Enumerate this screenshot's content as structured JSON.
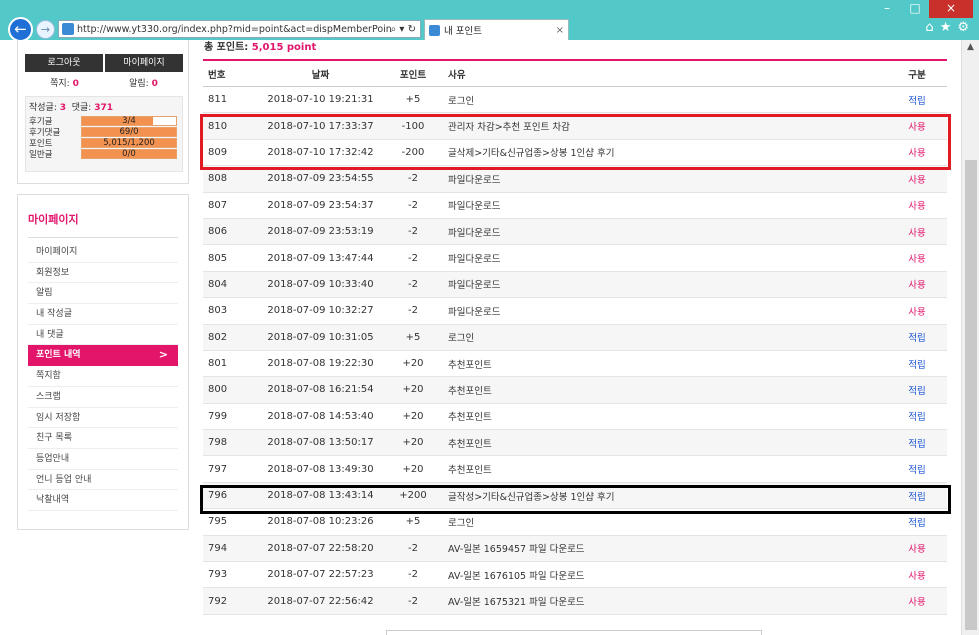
{
  "browser": {
    "url": "http://www.yt330.org/index.php?mid=point&act=dispMemberPointHistory",
    "address_icons": "⌕ ▾ ↻",
    "tab_label": "내 포인트",
    "tab_close": "×",
    "win_minimize": "–",
    "win_maximize": "□",
    "win_close": "×",
    "back": "←",
    "forward": "→",
    "home_icon": "⌂",
    "star_icon": "★",
    "gear_icon": "⚙"
  },
  "sidebar": {
    "logout": "로그아웃",
    "mypage": "마이페이지",
    "note_label": "쪽지: ",
    "note_count": "0",
    "alert_label": "알림: ",
    "alert_count": "0",
    "posts_label": "작성글: ",
    "posts_count": "3",
    "comments_label": "댓글: ",
    "comments_count": "371",
    "stats": [
      {
        "label": "후기글",
        "value": "3/4",
        "fill": 0.75
      },
      {
        "label": "후기댓글",
        "value": "69/0",
        "fill": 1.0
      },
      {
        "label": "포인트",
        "value": "5,015/1,200",
        "fill": 1.0
      },
      {
        "label": "일반글",
        "value": "0/0",
        "fill": 1.0
      }
    ],
    "menu_title": "마이페이지",
    "menu": [
      "마이페이지",
      "회원정보",
      "알림",
      "내 작성글",
      "내 댓글",
      "포인트 내역",
      "쪽지함",
      "스크랩",
      "임시 저장함",
      "친구 목록",
      "등업안내",
      "언니 등업 안내",
      "낙찰내역"
    ],
    "active_index": 5,
    "chevron": ">"
  },
  "points": {
    "total_label": "총 포인트: ",
    "total_value": "5,015 point",
    "headers": {
      "no": "번호",
      "date": "날짜",
      "point": "포인트",
      "reason": "사유",
      "type": "구분"
    },
    "rows": [
      {
        "no": "811",
        "date": "2018-07-10 19:21:31",
        "point": "+5",
        "reason": "로그인",
        "type": "적립"
      },
      {
        "no": "810",
        "date": "2018-07-10 17:33:37",
        "point": "-100",
        "reason": "관리자 차감>추천 포인트 차감",
        "type": "사용"
      },
      {
        "no": "809",
        "date": "2018-07-10 17:32:42",
        "point": "-200",
        "reason": "글삭제>기타&신규업종>상봉 1인샵 후기",
        "type": "사용"
      },
      {
        "no": "808",
        "date": "2018-07-09 23:54:55",
        "point": "-2",
        "reason": "파일다운로드",
        "type": "사용"
      },
      {
        "no": "807",
        "date": "2018-07-09 23:54:37",
        "point": "-2",
        "reason": "파일다운로드",
        "type": "사용"
      },
      {
        "no": "806",
        "date": "2018-07-09 23:53:19",
        "point": "-2",
        "reason": "파일다운로드",
        "type": "사용"
      },
      {
        "no": "805",
        "date": "2018-07-09 13:47:44",
        "point": "-2",
        "reason": "파일다운로드",
        "type": "사용"
      },
      {
        "no": "804",
        "date": "2018-07-09 10:33:40",
        "point": "-2",
        "reason": "파일다운로드",
        "type": "사용"
      },
      {
        "no": "803",
        "date": "2018-07-09 10:32:27",
        "point": "-2",
        "reason": "파일다운로드",
        "type": "사용"
      },
      {
        "no": "802",
        "date": "2018-07-09 10:31:05",
        "point": "+5",
        "reason": "로그인",
        "type": "적립"
      },
      {
        "no": "801",
        "date": "2018-07-08 19:22:30",
        "point": "+20",
        "reason": "추천포인트",
        "type": "적립"
      },
      {
        "no": "800",
        "date": "2018-07-08 16:21:54",
        "point": "+20",
        "reason": "추천포인트",
        "type": "적립"
      },
      {
        "no": "799",
        "date": "2018-07-08 14:53:40",
        "point": "+20",
        "reason": "추천포인트",
        "type": "적립"
      },
      {
        "no": "798",
        "date": "2018-07-08 13:50:17",
        "point": "+20",
        "reason": "추천포인트",
        "type": "적립"
      },
      {
        "no": "797",
        "date": "2018-07-08 13:49:30",
        "point": "+20",
        "reason": "추천포인트",
        "type": "적립"
      },
      {
        "no": "796",
        "date": "2018-07-08 13:43:14",
        "point": "+200",
        "reason": "글작성>기타&신규업종>상봉 1인샵 후기",
        "type": "적립"
      },
      {
        "no": "795",
        "date": "2018-07-08 10:23:26",
        "point": "+5",
        "reason": "로그인",
        "type": "적립"
      },
      {
        "no": "794",
        "date": "2018-07-07 22:58:20",
        "point": "-2",
        "reason": "AV-일본 1659457 파일 다운로드",
        "type": "사용"
      },
      {
        "no": "793",
        "date": "2018-07-07 22:57:23",
        "point": "-2",
        "reason": "AV-일본 1676105 파일 다운로드",
        "type": "사용"
      },
      {
        "no": "792",
        "date": "2018-07-07 22:56:42",
        "point": "-2",
        "reason": "AV-일본 1675321 파일 다운로드",
        "type": "사용"
      }
    ]
  },
  "colors": {
    "accent": "#e2156b",
    "earn": "#1a53d6",
    "highlight_red": "#e01b24",
    "highlight_black": "#000000"
  }
}
